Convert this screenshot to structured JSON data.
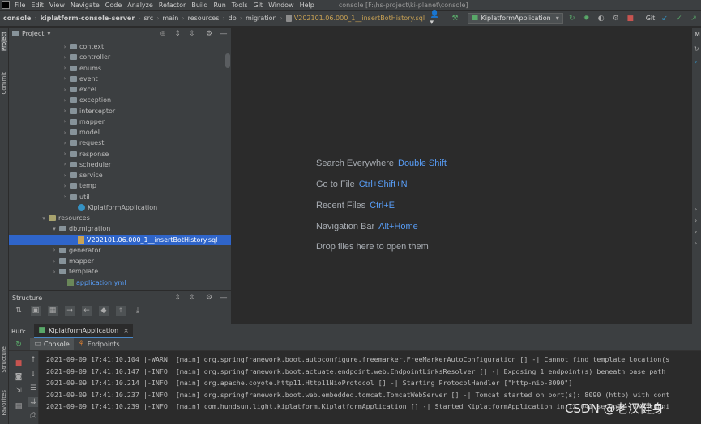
{
  "menubar": {
    "items": [
      "File",
      "Edit",
      "View",
      "Navigate",
      "Code",
      "Analyze",
      "Refactor",
      "Build",
      "Run",
      "Tools",
      "Git",
      "Window",
      "Help"
    ],
    "title": "console [F:\\hs-project\\ki-planet\\console]"
  },
  "navbar": {
    "crumbs": [
      "console",
      "kiplatform-console-server",
      "src",
      "main",
      "resources",
      "db",
      "migration"
    ],
    "file": "V202101.06.000_1__insertBotHistory.sql",
    "run_config": "KiplatformApplication",
    "git_label": "Git:"
  },
  "project": {
    "header": "Project",
    "tree": [
      {
        "label": "context",
        "indent": 76,
        "kind": "folder",
        "arrow": "›"
      },
      {
        "label": "controller",
        "indent": 76,
        "kind": "folder",
        "arrow": "›"
      },
      {
        "label": "enums",
        "indent": 76,
        "kind": "folder",
        "arrow": "›"
      },
      {
        "label": "event",
        "indent": 76,
        "kind": "folder",
        "arrow": "›"
      },
      {
        "label": "excel",
        "indent": 76,
        "kind": "folder",
        "arrow": "›"
      },
      {
        "label": "exception",
        "indent": 76,
        "kind": "folder",
        "arrow": "›"
      },
      {
        "label": "interceptor",
        "indent": 76,
        "kind": "folder",
        "arrow": "›"
      },
      {
        "label": "mapper",
        "indent": 76,
        "kind": "folder",
        "arrow": "›"
      },
      {
        "label": "model",
        "indent": 76,
        "kind": "folder",
        "arrow": "›"
      },
      {
        "label": "request",
        "indent": 76,
        "kind": "folder",
        "arrow": "›"
      },
      {
        "label": "response",
        "indent": 76,
        "kind": "folder",
        "arrow": "›"
      },
      {
        "label": "scheduler",
        "indent": 76,
        "kind": "folder",
        "arrow": "›"
      },
      {
        "label": "service",
        "indent": 76,
        "kind": "folder",
        "arrow": "›"
      },
      {
        "label": "temp",
        "indent": 76,
        "kind": "folder",
        "arrow": "›"
      },
      {
        "label": "util",
        "indent": 76,
        "kind": "folder",
        "arrow": "›"
      },
      {
        "label": "KiplatformApplication",
        "indent": 86,
        "kind": "java",
        "arrow": ""
      },
      {
        "label": "resources",
        "indent": 50,
        "kind": "res",
        "arrow": "⌄"
      },
      {
        "label": "db.migration",
        "indent": 63,
        "kind": "folder",
        "arrow": "⌄"
      },
      {
        "label": "V202101.06.000_1__insertBotHistory.sql",
        "indent": 86,
        "kind": "sql",
        "arrow": "",
        "selected": true
      },
      {
        "label": "generator",
        "indent": 63,
        "kind": "folder",
        "arrow": "›"
      },
      {
        "label": "mapper",
        "indent": 63,
        "kind": "folder",
        "arrow": "›"
      },
      {
        "label": "template",
        "indent": 63,
        "kind": "folder",
        "arrow": "›"
      },
      {
        "label": "application.yml",
        "indent": 73,
        "kind": "yml",
        "arrow": ""
      }
    ]
  },
  "structure": {
    "header": "Structure"
  },
  "editor": {
    "hints": [
      {
        "text": "Search Everywhere",
        "key": "Double Shift"
      },
      {
        "text": "Go to File",
        "key": "Ctrl+Shift+N"
      },
      {
        "text": "Recent Files",
        "key": "Ctrl+E"
      },
      {
        "text": "Navigation Bar",
        "key": "Alt+Home"
      },
      {
        "text": "Drop files here to open them",
        "key": ""
      }
    ]
  },
  "left_stripe": {
    "project": "Project",
    "commit": "Commit",
    "structure": "Structure",
    "favorites": "Favorites"
  },
  "run": {
    "label": "Run:",
    "tab": "KiplatformApplication",
    "console_tab": "Console",
    "endpoints_tab": "Endpoints",
    "logs": [
      "2021-09-09 17:41:10.104 |-WARN  [main] org.springframework.boot.autoconfigure.freemarker.FreeMarkerAutoConfiguration [] -| Cannot find template location(s",
      "2021-09-09 17:41:10.147 |-INFO  [main] org.springframework.boot.actuate.endpoint.web.EndpointLinksResolver [] -| Exposing 1 endpoint(s) beneath base path",
      "2021-09-09 17:41:10.214 |-INFO  [main] org.apache.coyote.http11.Http11NioProtocol [] -| Starting ProtocolHandler [\"http-nio-8090\"]",
      "2021-09-09 17:41:10.237 |-INFO  [main] org.springframework.boot.web.embedded.tomcat.TomcatWebServer [] -| Tomcat started on port(s): 8090 (http) with cont",
      "2021-09-09 17:41:10.239 |-INFO  [main] com.hundsun.light.kiplatform.KiplatformApplication [] -| Started KiplatformApplication in 12.041 seconds (JVM runni"
    ]
  },
  "watermark": "CSDN @老汉健身",
  "right_stripe": {
    "label": "M"
  }
}
